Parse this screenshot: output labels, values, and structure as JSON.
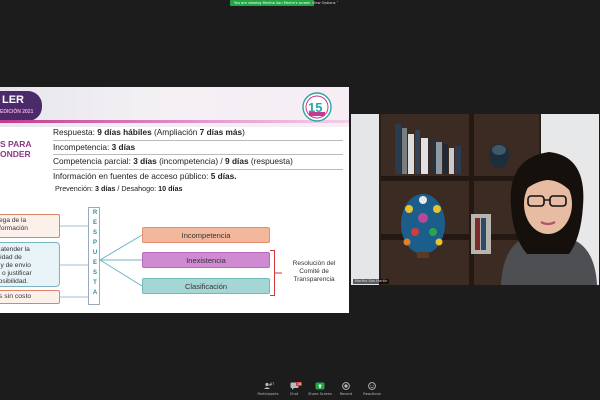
{
  "topbar": {
    "sharing_banner": "You are viewing Martha San Martin's screen",
    "view_options": "View Options ˅"
  },
  "slide": {
    "logo_left_text": "LER",
    "logo_left_sub": "EDICIÓN 2021",
    "title_line1": "S PARA",
    "title_line2": "ONDER",
    "bullets": [
      {
        "pre": "Respuesta: ",
        "bold1": "9 días hábiles",
        "mid": " (Ampliación ",
        "bold2": "7 días más",
        "post": ")"
      },
      {
        "pre": "Incompetencia: ",
        "bold1": "3 días",
        "mid": "",
        "bold2": "",
        "post": ""
      },
      {
        "pre": "Competencia parcial: ",
        "bold1": "3 días",
        "mid": " (incompetencia) / ",
        "bold2": "9 días",
        "post": " (respuesta)"
      },
      {
        "pre": "Información en fuentes de acceso público: ",
        "bold1": "5 días.",
        "mid": "",
        "bold2": "",
        "post": ""
      }
    ],
    "prevencion": {
      "pre": "Prevención: ",
      "bold1": "3 días",
      "mid": " / Desahogo: ",
      "bold2": "10 días"
    }
  },
  "diagram": {
    "left_box_1": "ega de la\nformación",
    "left_box_2": "e atender la\nalidad de\na y de envío\ns, o justificar\nposibilidad.",
    "left_box_3": "s sin costo",
    "respuesta_letters": [
      "R",
      "E",
      "S",
      "P",
      "U",
      "E",
      "S",
      "T",
      "A"
    ],
    "options": [
      "Incompetencia",
      "Inexistencia",
      "Clasificación"
    ],
    "resolucion": "Resolución del\nComité de\nTransparencia"
  },
  "camera": {
    "name_tag": "Martha San Martin"
  },
  "toolbar": {
    "participants_count": "47",
    "chat_badge": "18",
    "buttons": [
      {
        "name": "participants",
        "label": "Participants",
        "icon": "people-icon"
      },
      {
        "name": "chat",
        "label": "Chat",
        "icon": "chat-icon"
      },
      {
        "name": "share-screen",
        "label": "Share Screen",
        "icon": "share-screen-icon"
      },
      {
        "name": "record",
        "label": "Record",
        "icon": "record-icon"
      },
      {
        "name": "reactions",
        "label": "Reactions",
        "icon": "smiley-icon"
      }
    ]
  },
  "colors": {
    "share_green": "#23a445",
    "slide_purple": "#8b3a86",
    "incompetencia": "#f3b79c",
    "inexistencia": "#cf8ad1",
    "clasificacion": "#a4d6d6",
    "bracket_red": "#d23a3a"
  }
}
